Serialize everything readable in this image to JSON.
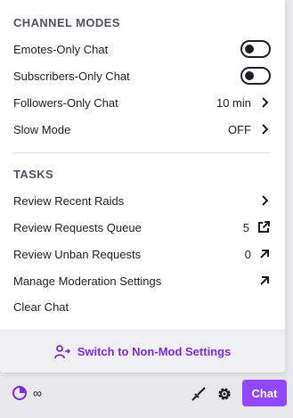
{
  "channel_modes": {
    "title": "CHANNEL MODES",
    "emotes_only": {
      "label": "Emotes-Only Chat",
      "enabled": false
    },
    "subscribers_only": {
      "label": "Subscribers-Only Chat",
      "enabled": false
    },
    "followers_only": {
      "label": "Followers-Only Chat",
      "value": "10 min"
    },
    "slow_mode": {
      "label": "Slow Mode",
      "value": "OFF"
    }
  },
  "tasks": {
    "title": "TASKS",
    "recent_raids": {
      "label": "Review Recent Raids"
    },
    "requests_queue": {
      "label": "Review Requests Queue",
      "count": "5"
    },
    "unban_requests": {
      "label": "Review Unban Requests",
      "count": "0"
    },
    "moderation_settings": {
      "label": "Manage Moderation Settings"
    },
    "clear_chat": {
      "label": "Clear Chat"
    }
  },
  "footer": {
    "switch_label": "Switch to Non-Mod Settings"
  },
  "bottom_bar": {
    "infinity": "∞",
    "chat_label": "Chat"
  },
  "colors": {
    "accent": "#9147ff",
    "accent_text": "#772ce8",
    "danger": "#d63e3e"
  },
  "icons": [
    "chevron-right-icon",
    "external-link-icon",
    "arrow-up-right-icon",
    "user-switch-icon",
    "timer-icon",
    "sword-icon",
    "gear-icon"
  ]
}
